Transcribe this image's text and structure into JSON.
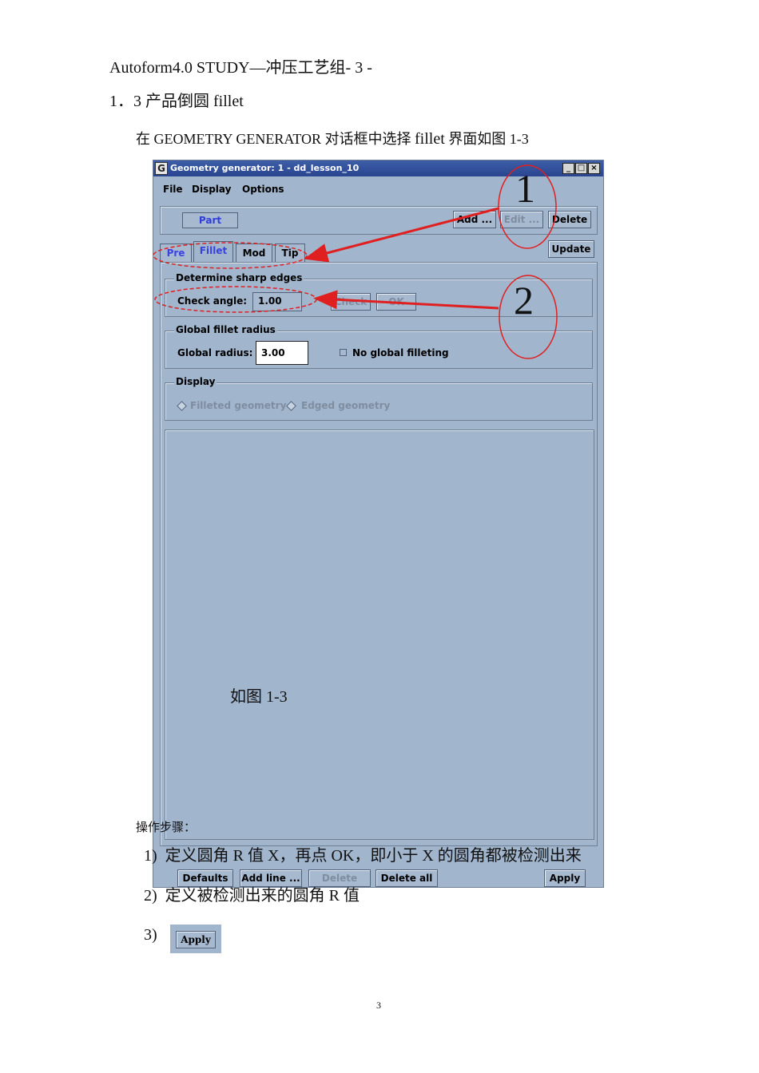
{
  "document": {
    "header": "Autoform4.0 STUDY—冲压工艺组- 3 -",
    "section": "1．3  产品倒圆 fillet",
    "intro_prefix": "在 GEOMETRY  GENERATOR  对话框中选择 ",
    "intro_fillet": "fillet",
    "intro_suffix": "  界面如图 1-3",
    "figure_caption": "如图 1-3",
    "steps_label": "操作步骤：",
    "steps": [
      {
        "num": "1)",
        "text": "定义圆角 R 值 X，再点 OK，即小于 X 的圆角都被检测出来"
      },
      {
        "num": "2)",
        "text": "定义被检测出来的圆角 R 值"
      },
      {
        "num": "3)",
        "text": ""
      }
    ],
    "apply_image_label": "Apply",
    "page_number": "3"
  },
  "window": {
    "icon": "G",
    "title": "Geometry generator: 1  -  dd_lesson_10",
    "controls": [
      "_",
      "□",
      "×"
    ],
    "menu": [
      "File",
      "Display",
      "Options"
    ],
    "part_label": "Part",
    "top_buttons": {
      "add": "Add ...",
      "edit": "Edit ...",
      "delete": "Delete",
      "update": "Update"
    },
    "tabs": [
      "Pre",
      "Fillet",
      "Mod",
      "Tip"
    ],
    "sharp_edges": {
      "group": "Determine sharp edges",
      "check_angle_label": "Check angle:",
      "check_angle_value": "1.00",
      "check_button": "Check",
      "ok_button": "OK"
    },
    "global_fillet": {
      "group": "Global fillet radius",
      "radius_label": "Global radius:",
      "radius_value": "3.00",
      "no_global_label": "No global filleting"
    },
    "display": {
      "group": "Display",
      "option1": "Filleted geometry",
      "option2": "Edged geometry"
    },
    "bottom_buttons": {
      "defaults": "Defaults",
      "add_line": "Add line ...",
      "delete": "Delete",
      "delete_all": "Delete all",
      "apply": "Apply"
    }
  },
  "annotations": {
    "marker1": "1",
    "marker2": "2",
    "color": "#e02020"
  }
}
